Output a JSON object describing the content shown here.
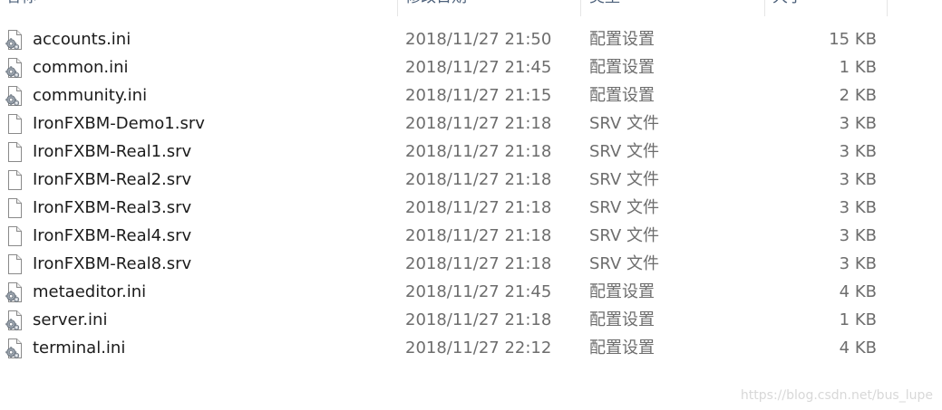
{
  "header": {
    "name": "名称",
    "date": "修改日期",
    "type": "类型",
    "size": "大小"
  },
  "files": [
    {
      "name": "accounts.ini",
      "date": "2018/11/27 21:50",
      "type": "配置设置",
      "size": "15 KB",
      "icon": "settings-file-icon"
    },
    {
      "name": "common.ini",
      "date": "2018/11/27 21:45",
      "type": "配置设置",
      "size": "1 KB",
      "icon": "settings-file-icon"
    },
    {
      "name": "community.ini",
      "date": "2018/11/27 21:15",
      "type": "配置设置",
      "size": "2 KB",
      "icon": "settings-file-icon"
    },
    {
      "name": "IronFXBM-Demo1.srv",
      "date": "2018/11/27 21:18",
      "type": "SRV 文件",
      "size": "3 KB",
      "icon": "blank-file-icon"
    },
    {
      "name": "IronFXBM-Real1.srv",
      "date": "2018/11/27 21:18",
      "type": "SRV 文件",
      "size": "3 KB",
      "icon": "blank-file-icon"
    },
    {
      "name": "IronFXBM-Real2.srv",
      "date": "2018/11/27 21:18",
      "type": "SRV 文件",
      "size": "3 KB",
      "icon": "blank-file-icon"
    },
    {
      "name": "IronFXBM-Real3.srv",
      "date": "2018/11/27 21:18",
      "type": "SRV 文件",
      "size": "3 KB",
      "icon": "blank-file-icon"
    },
    {
      "name": "IronFXBM-Real4.srv",
      "date": "2018/11/27 21:18",
      "type": "SRV 文件",
      "size": "3 KB",
      "icon": "blank-file-icon"
    },
    {
      "name": "IronFXBM-Real8.srv",
      "date": "2018/11/27 21:18",
      "type": "SRV 文件",
      "size": "3 KB",
      "icon": "blank-file-icon"
    },
    {
      "name": "metaeditor.ini",
      "date": "2018/11/27 21:45",
      "type": "配置设置",
      "size": "4 KB",
      "icon": "settings-file-icon"
    },
    {
      "name": "server.ini",
      "date": "2018/11/27 21:18",
      "type": "配置设置",
      "size": "1 KB",
      "icon": "settings-file-icon"
    },
    {
      "name": "terminal.ini",
      "date": "2018/11/27 22:12",
      "type": "配置设置",
      "size": "4 KB",
      "icon": "settings-file-icon"
    }
  ],
  "watermark": "https://blog.csdn.net/bus_lupe"
}
